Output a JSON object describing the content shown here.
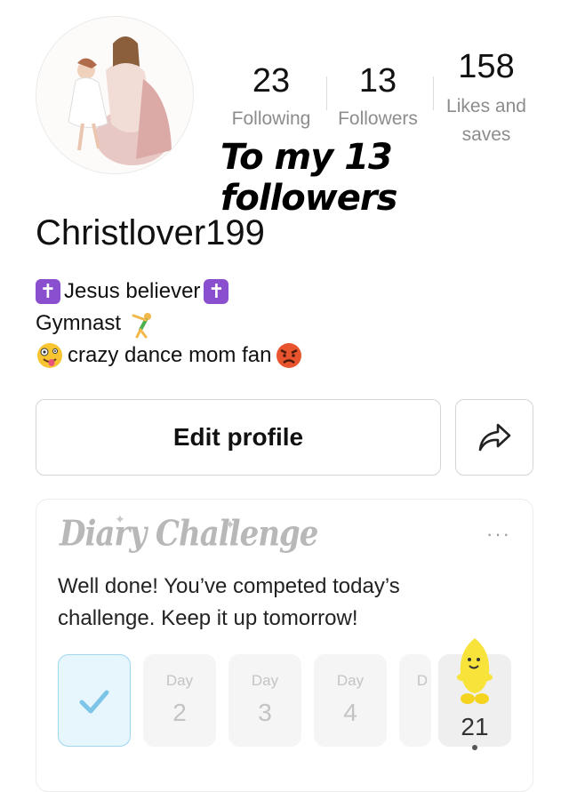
{
  "profile": {
    "username": "Christlover199",
    "stats": {
      "following": {
        "value": "23",
        "label": "Following"
      },
      "followers": {
        "value": "13",
        "label": "Followers"
      },
      "likes": {
        "value": "158",
        "label_line1": "Likes and",
        "label_line2": "saves"
      }
    },
    "overlay_text": "To my 13 followers",
    "bio": {
      "line1": "Jesus believer",
      "line2": "Gymnast",
      "line3": "crazy dance mom fan"
    }
  },
  "buttons": {
    "edit_profile": "Edit profile",
    "share_icon": "share-arrow-icon"
  },
  "diary": {
    "title": "Diary Challenge",
    "more": "···",
    "message": "Well done! You’ve competed today’s challenge. Keep it up tomorrow!",
    "days": [
      {
        "label": "",
        "num": "",
        "done": true
      },
      {
        "label": "Day",
        "num": "2"
      },
      {
        "label": "Day",
        "num": "3"
      },
      {
        "label": "Day",
        "num": "4"
      },
      {
        "label": "D",
        "num": ""
      },
      {
        "label": "",
        "num": "21"
      }
    ]
  },
  "colors": {
    "accent_check": "#7cc4e8",
    "cross_purple": "#8a4fcf",
    "muted_text": "#8c8c8c"
  }
}
